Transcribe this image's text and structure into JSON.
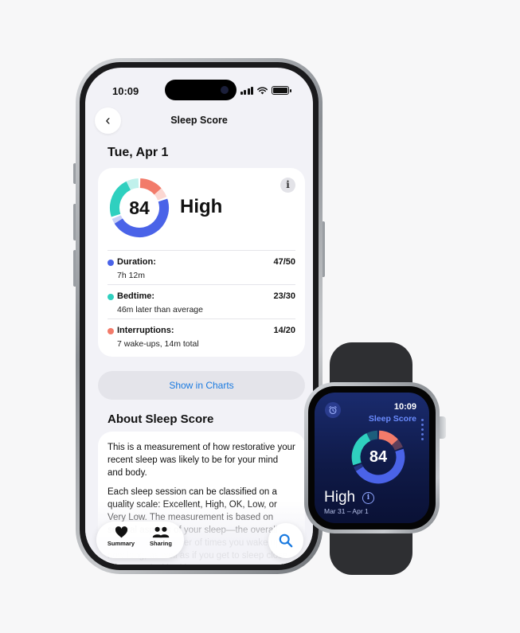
{
  "phone": {
    "status": {
      "time": "10:09"
    },
    "nav": {
      "back_glyph": "‹",
      "title": "Sleep Score"
    },
    "date": "Tue, Apr 1",
    "score_card": {
      "score": "84",
      "level": "High",
      "info_glyph": "i",
      "ring": {
        "duration_fraction": 0.94,
        "bedtime_fraction": 0.77,
        "interruptions_fraction": 0.7
      },
      "metrics": [
        {
          "label": "Duration:",
          "value": "7h 12m",
          "score": "47/50",
          "color": "#4a63e8"
        },
        {
          "label": "Bedtime:",
          "value": "46m later than average",
          "score": "23/30",
          "color": "#2fd0bf"
        },
        {
          "label": "Interruptions:",
          "value": "7 wake-ups, 14m total",
          "score": "14/20",
          "color": "#f27b6a"
        }
      ]
    },
    "charts_button": "Show in Charts",
    "about": {
      "heading": "About Sleep Score",
      "paragraphs": [
        "This is a measurement of how restorative your recent sleep was likely to be for your mind and body.",
        "Each sleep session can be classified on a quality scale: Excellent, High, OK, Low, or Very Low. The measurement is based on several aspects of your sleep—the overall duration, the number of times you wake up, how long, as well as if you get to sleep close to your typical bedtime."
      ]
    },
    "tabbar": {
      "tabs": [
        {
          "label": "Summary",
          "icon": "heart-icon"
        },
        {
          "label": "Sharing",
          "icon": "people-icon"
        }
      ],
      "search_icon": "search-icon"
    }
  },
  "watch": {
    "time": "10:09",
    "title": "Sleep Score",
    "score": "84",
    "level": "High",
    "info_glyph": "i",
    "range": "Mar 31 – Apr 1",
    "icon": "alarm-icon"
  },
  "colors": {
    "duration": "#4a63e8",
    "bedtime": "#2fd0bf",
    "interruptions": "#f27b6a",
    "link": "#1a7ae0",
    "watch_accent": "#6b8cff"
  }
}
